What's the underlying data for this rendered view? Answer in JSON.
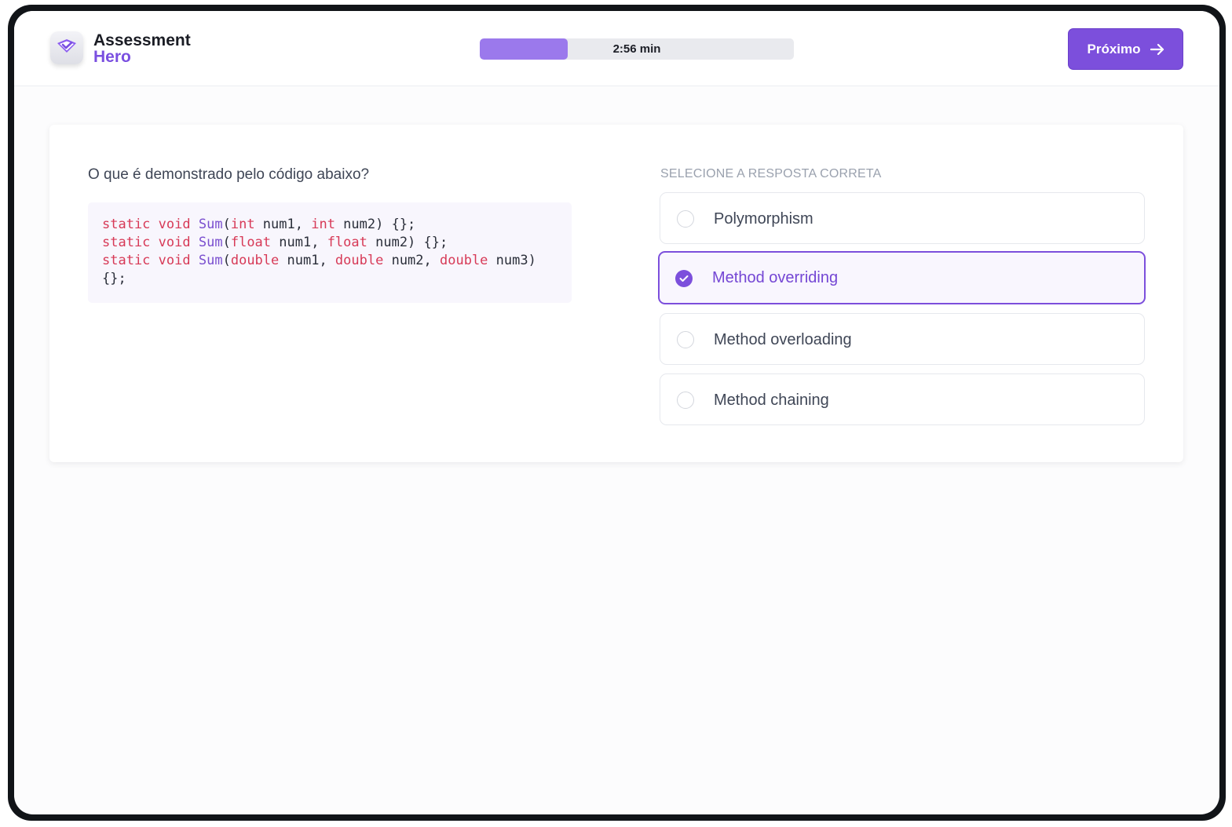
{
  "header": {
    "brand_line1": "Assessment",
    "brand_line2": "Hero",
    "logo_icon": "heart-check-icon",
    "timer_label": "2:56 min",
    "progress_fraction": 0.28,
    "next_button_label": "Próximo",
    "next_button_icon": "arrow-right-icon"
  },
  "question": {
    "prompt": "O que é demonstrado pelo código abaixo?",
    "code_lines": [
      "static void Sum(int num1, int num2) {};",
      "static void Sum(float num1, float num2) {};",
      "static void Sum(double num1, double num2, double num3)",
      "{};"
    ]
  },
  "answers": {
    "instruction": "SELECIONE A RESPOSTA CORRETA",
    "options": [
      {
        "label": "Polymorphism",
        "selected": false
      },
      {
        "label": "Method overriding",
        "selected": true
      },
      {
        "label": "Method overloading",
        "selected": false
      },
      {
        "label": "Method chaining",
        "selected": false
      }
    ]
  },
  "colors": {
    "accent": "#7c4fdc",
    "progress_fill": "#9b79ec",
    "code_keyword": "#d73a57",
    "code_function": "#7a4fcf"
  }
}
